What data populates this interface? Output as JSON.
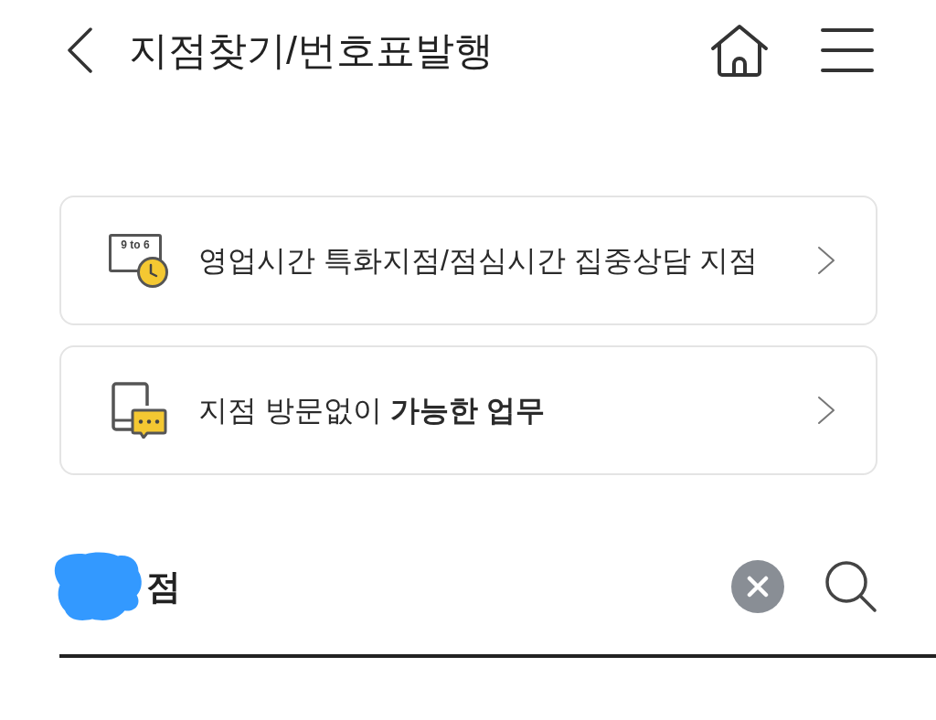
{
  "header": {
    "title": "지점찾기/번호표발행"
  },
  "menu_cards": [
    {
      "kind": "hours",
      "label": "영업시간 특화지점/점심시간 집중상담 지점",
      "badge": "9 to 6"
    },
    {
      "kind": "remote",
      "label": "지점 방문없이 **가능한 업무**"
    }
  ],
  "search": {
    "value": "점"
  }
}
